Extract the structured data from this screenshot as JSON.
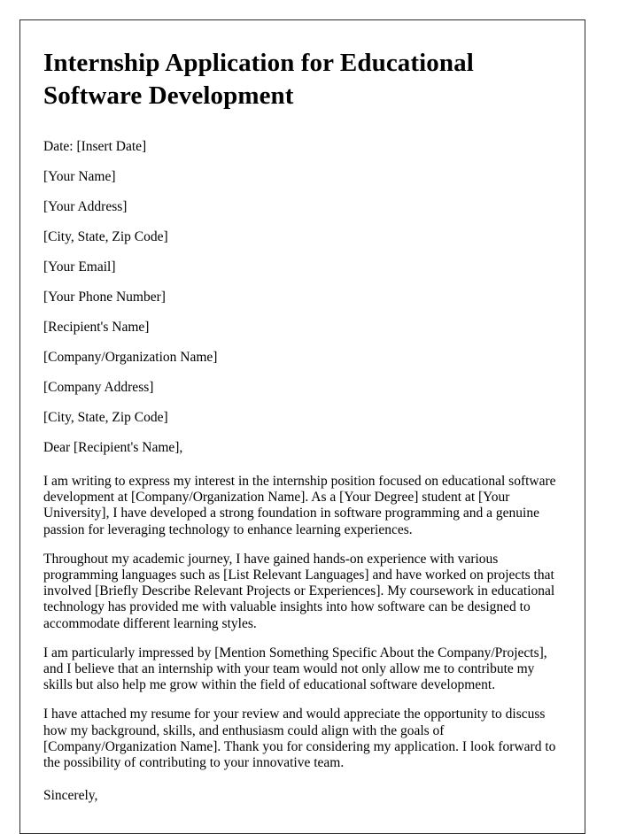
{
  "document": {
    "title": "Internship Application for Educational Software Development",
    "date_line": "Date: [Insert Date]",
    "sender_block": [
      "[Your Name]",
      "[Your Address]",
      "[City, State, Zip Code]",
      "[Your Email]",
      "[Your Phone Number]"
    ],
    "recipient_block": [
      "[Recipient's Name]",
      "[Company/Organization Name]",
      "[Company Address]",
      "[City, State, Zip Code]"
    ],
    "salutation": "Dear [Recipient's Name],",
    "paragraphs": [
      "I am writing to express my interest in the internship position focused on educational software development at [Company/Organization Name]. As a [Your Degree] student at [Your University], I have developed a strong foundation in software programming and a genuine passion for leveraging technology to enhance learning experiences.",
      "Throughout my academic journey, I have gained hands-on experience with various programming languages such as [List Relevant Languages] and have worked on projects that involved [Briefly Describe Relevant Projects or Experiences]. My coursework in educational technology has provided me with valuable insights into how software can be designed to accommodate different learning styles.",
      "I am particularly impressed by [Mention Something Specific About the Company/Projects], and I believe that an internship with your team would not only allow me to contribute my skills but also help me grow within the field of educational software development.",
      "I have attached my resume for your review and would appreciate the opportunity to discuss how my background, skills, and enthusiasm could align with the goals of [Company/Organization Name]. Thank you for considering my application. I look forward to the possibility of contributing to your innovative team."
    ],
    "signoff": "Sincerely,"
  },
  "style": {
    "page_background": "#ffffff",
    "text_color": "#000000",
    "border_color": "#2b2b2b"
  }
}
